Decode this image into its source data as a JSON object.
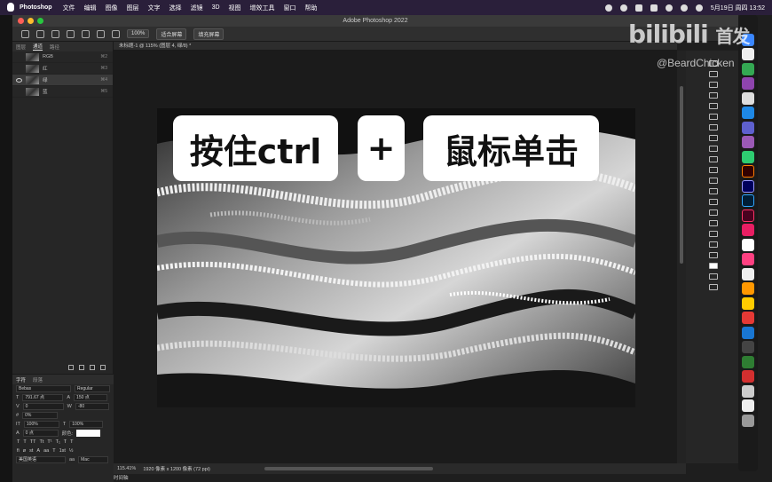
{
  "menubar": {
    "app": "Photoshop",
    "items": [
      "文件",
      "编辑",
      "图像",
      "图层",
      "文字",
      "选择",
      "滤镜",
      "3D",
      "视图",
      "增效工具",
      "窗口",
      "帮助"
    ],
    "clock": "5月19日 周四  13:52"
  },
  "window": {
    "title": "Adobe Photoshop 2022"
  },
  "options": {
    "zoom": "100%",
    "fit_screen": "适合屏幕",
    "fill_screen": "填充屏幕"
  },
  "panels": {
    "tabs": [
      "图层",
      "通道",
      "路径"
    ],
    "channels": [
      {
        "name": "RGB",
        "key": "⌘2"
      },
      {
        "name": "红",
        "key": "⌘3"
      },
      {
        "name": "绿",
        "key": "⌘4"
      },
      {
        "name": "蓝",
        "key": "⌘5"
      }
    ]
  },
  "character": {
    "tabs": [
      "字符",
      "段落"
    ],
    "font_family": "Bebas",
    "font_style": "Regular",
    "font_size": "791.67 点",
    "leading": "150 点",
    "kerning": "0",
    "tracking": "-80",
    "scale_pct": "0%",
    "vscale": "100%",
    "hscale": "100%",
    "baseline": "0 点",
    "color_label": "颜色:",
    "language": "美国英语",
    "aa": "Mac"
  },
  "document": {
    "tab": "未标题-1 @ 115% (图层 4, 绿/8) *",
    "zoom": "115.41%",
    "info": "1920 像素 x 1200 像素 (72 ppi)",
    "timeline": "时间轴"
  },
  "captions": {
    "left": "按住ctrl",
    "plus": "+",
    "right": "鼠标单击"
  },
  "watermark": {
    "logo": "bilibili",
    "tag": "首发",
    "user": "@BeardChicken"
  }
}
